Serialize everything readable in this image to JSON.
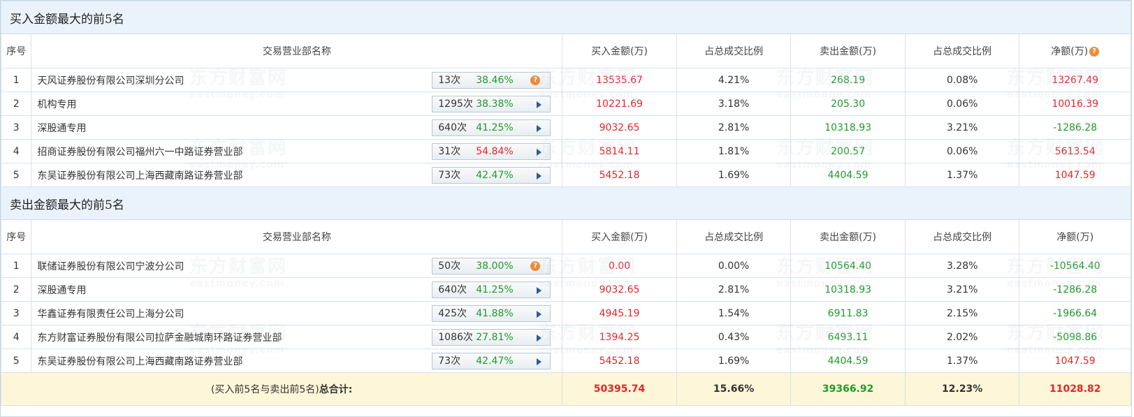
{
  "buy_section": {
    "title": "买入金额最大的前5名",
    "headers": [
      "序号",
      "交易营业部名称",
      "买入金额(万)",
      "占总成交比例",
      "卖出金额(万)",
      "占总成交比例",
      "净额(万)"
    ],
    "rows": [
      {
        "idx": "1",
        "name": "天风证券股份有限公司深圳分公司",
        "count": "13次",
        "pct": "38.46%",
        "pct_color": "green",
        "btn": "help",
        "buy": "13535.67",
        "buy_ratio": "4.21%",
        "sell": "268.19",
        "sell_ratio": "0.08%",
        "net": "13267.49",
        "net_color": "red"
      },
      {
        "idx": "2",
        "name": "机构专用",
        "count": "1295次",
        "pct": "38.38%",
        "pct_color": "green",
        "btn": "expand",
        "buy": "10221.69",
        "buy_ratio": "3.18%",
        "sell": "205.30",
        "sell_ratio": "0.06%",
        "net": "10016.39",
        "net_color": "red"
      },
      {
        "idx": "3",
        "name": "深股通专用",
        "count": "640次",
        "pct": "41.25%",
        "pct_color": "green",
        "btn": "expand",
        "buy": "9032.65",
        "buy_ratio": "2.81%",
        "sell": "10318.93",
        "sell_ratio": "3.21%",
        "net": "-1286.28",
        "net_color": "green"
      },
      {
        "idx": "4",
        "name": "招商证券股份有限公司福州六一中路证券营业部",
        "count": "31次",
        "pct": "54.84%",
        "pct_color": "red",
        "btn": "expand",
        "buy": "5814.11",
        "buy_ratio": "1.81%",
        "sell": "200.57",
        "sell_ratio": "0.06%",
        "net": "5613.54",
        "net_color": "red"
      },
      {
        "idx": "5",
        "name": "东吴证券股份有限公司上海西藏南路证券营业部",
        "count": "73次",
        "pct": "42.47%",
        "pct_color": "green",
        "btn": "expand",
        "buy": "5452.18",
        "buy_ratio": "1.69%",
        "sell": "4404.59",
        "sell_ratio": "1.37%",
        "net": "1047.59",
        "net_color": "red"
      }
    ]
  },
  "sell_section": {
    "title": "卖出金额最大的前5名",
    "headers": [
      "序号",
      "交易营业部名称",
      "买入金额(万)",
      "占总成交比例",
      "卖出金额(万)",
      "占总成交比例",
      "净额(万)"
    ],
    "rows": [
      {
        "idx": "1",
        "name": "联储证券股份有限公司宁波分公司",
        "count": "50次",
        "pct": "38.00%",
        "pct_color": "green",
        "btn": "help",
        "buy": "0.00",
        "buy_ratio": "0.00%",
        "sell": "10564.40",
        "sell_ratio": "3.28%",
        "net": "-10564.40",
        "net_color": "green"
      },
      {
        "idx": "2",
        "name": "深股通专用",
        "count": "640次",
        "pct": "41.25%",
        "pct_color": "green",
        "btn": "expand",
        "buy": "9032.65",
        "buy_ratio": "2.81%",
        "sell": "10318.93",
        "sell_ratio": "3.21%",
        "net": "-1286.28",
        "net_color": "green"
      },
      {
        "idx": "3",
        "name": "华鑫证券有限责任公司上海分公司",
        "count": "425次",
        "pct": "41.88%",
        "pct_color": "green",
        "btn": "expand",
        "buy": "4945.19",
        "buy_ratio": "1.54%",
        "sell": "6911.83",
        "sell_ratio": "2.15%",
        "net": "-1966.64",
        "net_color": "green"
      },
      {
        "idx": "4",
        "name": "东方财富证券股份有限公司拉萨金融城南环路证券营业部",
        "count": "1086次",
        "pct": "27.81%",
        "pct_color": "green",
        "btn": "expand",
        "buy": "1394.25",
        "buy_ratio": "0.43%",
        "sell": "6493.11",
        "sell_ratio": "2.02%",
        "net": "-5098.86",
        "net_color": "green"
      },
      {
        "idx": "5",
        "name": "东吴证券股份有限公司上海西藏南路证券营业部",
        "count": "73次",
        "pct": "42.47%",
        "pct_color": "green",
        "btn": "expand",
        "buy": "5452.18",
        "buy_ratio": "1.69%",
        "sell": "4404.59",
        "sell_ratio": "1.37%",
        "net": "1047.59",
        "net_color": "red"
      }
    ]
  },
  "total": {
    "label_prefix": "(买入前5名与卖出前5名)",
    "label_bold": "总合计:",
    "buy": "50395.74",
    "buy_ratio": "15.66%",
    "sell": "39366.92",
    "sell_ratio": "12.23%",
    "net": "11028.82"
  },
  "watermark": {
    "cn": "东方财富网",
    "en": "eastmoney.com"
  },
  "colors": {
    "up": "#e0262b",
    "down": "#1f9a2a",
    "header_bg": "#eaf3fc",
    "total_bg": "#fdf6d8",
    "help_icon": "#f08a3b"
  }
}
